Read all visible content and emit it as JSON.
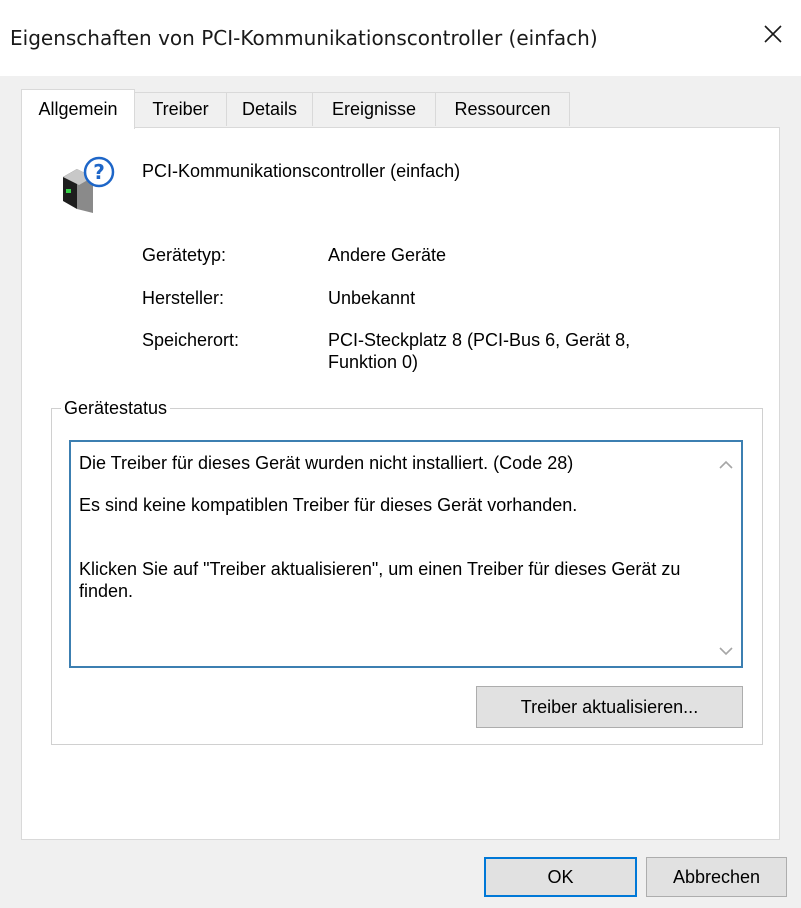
{
  "window": {
    "title": "Eigenschaften von PCI-Kommunikationscontroller (einfach)"
  },
  "tabs": [
    {
      "label": "Allgemein",
      "active": true
    },
    {
      "label": "Treiber"
    },
    {
      "label": "Details"
    },
    {
      "label": "Ereignisse"
    },
    {
      "label": "Ressourcen"
    }
  ],
  "device": {
    "name": "PCI-Kommunikationscontroller (einfach)",
    "icon": "unknown-device-icon"
  },
  "properties": {
    "type_label": "Gerätetyp:",
    "type_value": "Andere Geräte",
    "manufacturer_label": "Hersteller:",
    "manufacturer_value": "Unbekannt",
    "location_label": "Speicherort:",
    "location_value_line1": "PCI-Steckplatz 8 (PCI-Bus 6, Gerät 8,",
    "location_value_line2": "Funktion 0)"
  },
  "status": {
    "group_label": "Gerätestatus",
    "line1": "Die Treiber für dieses Gerät wurden nicht installiert. (Code 28)",
    "line2": "Es sind keine kompatiblen Treiber für dieses Gerät vorhanden.",
    "line3": "Klicken Sie auf \"Treiber aktualisieren\", um einen Treiber für dieses Gerät zu finden.",
    "update_button": "Treiber aktualisieren..."
  },
  "buttons": {
    "ok": "OK",
    "cancel": "Abbrechen"
  },
  "colors": {
    "focus_border": "#3c7fb1",
    "default_button_border": "#0078d7",
    "dialog_bg": "#f0f0f0"
  }
}
